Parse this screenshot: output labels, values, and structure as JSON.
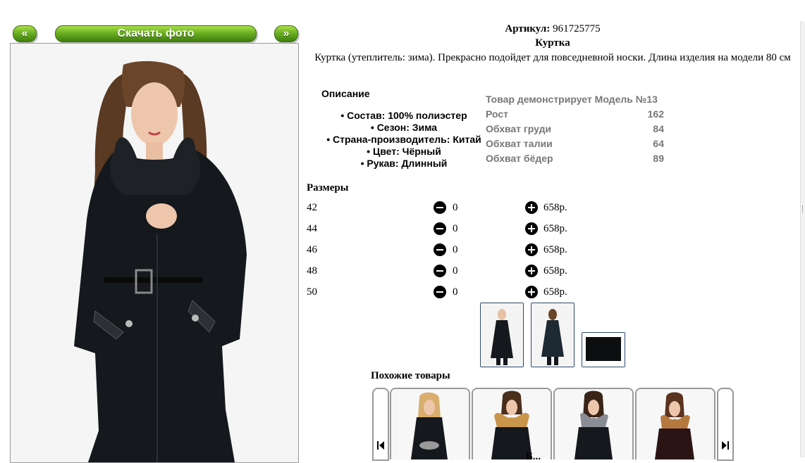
{
  "nav": {
    "prev_label": "«",
    "download_label": "Скачать фото",
    "next_label": "»"
  },
  "product": {
    "sku_label": "Артикул:",
    "sku_value": "961725775",
    "title": "Куртка",
    "description": "Куртка (утеплитель: зима). Прекрасно подойдет для повседневной носки. Длина изделия на модели 80 см"
  },
  "details": {
    "heading": "Описание",
    "attributes": [
      "Состав: 100% полиэстер",
      "Сезон: Зима",
      "Страна-производитель: Китай",
      "Цвет: Чёрный",
      "Рукав: Длинный"
    ]
  },
  "model": {
    "heading": "Товар демонстрирует Модель №13",
    "rows": [
      {
        "label": "Рост",
        "value": "162"
      },
      {
        "label": "Обхват груди",
        "value": "84"
      },
      {
        "label": "Обхват талии",
        "value": "64"
      },
      {
        "label": "Обхват бёдер",
        "value": "89"
      }
    ]
  },
  "sizes": {
    "heading": "Размеры",
    "rows": [
      {
        "size": "42",
        "qty": "0",
        "price": "658р."
      },
      {
        "size": "44",
        "qty": "0",
        "price": "658р."
      },
      {
        "size": "46",
        "qty": "0",
        "price": "658р."
      },
      {
        "size": "48",
        "qty": "0",
        "price": "658р."
      },
      {
        "size": "50",
        "qty": "0",
        "price": "658р."
      }
    ]
  },
  "similar": {
    "heading": "Похожие товары",
    "cut_label": "Б..."
  },
  "colors": {
    "green_top": "#a9e04a",
    "green_bottom": "#3f7e0d",
    "jacket": "#15181c",
    "fur": "#c9954a",
    "thumb_border": "#2d4a6b"
  },
  "icons": [
    "minus-circle-icon",
    "plus-circle-icon",
    "first-arrow-icon",
    "last-arrow-icon"
  ]
}
